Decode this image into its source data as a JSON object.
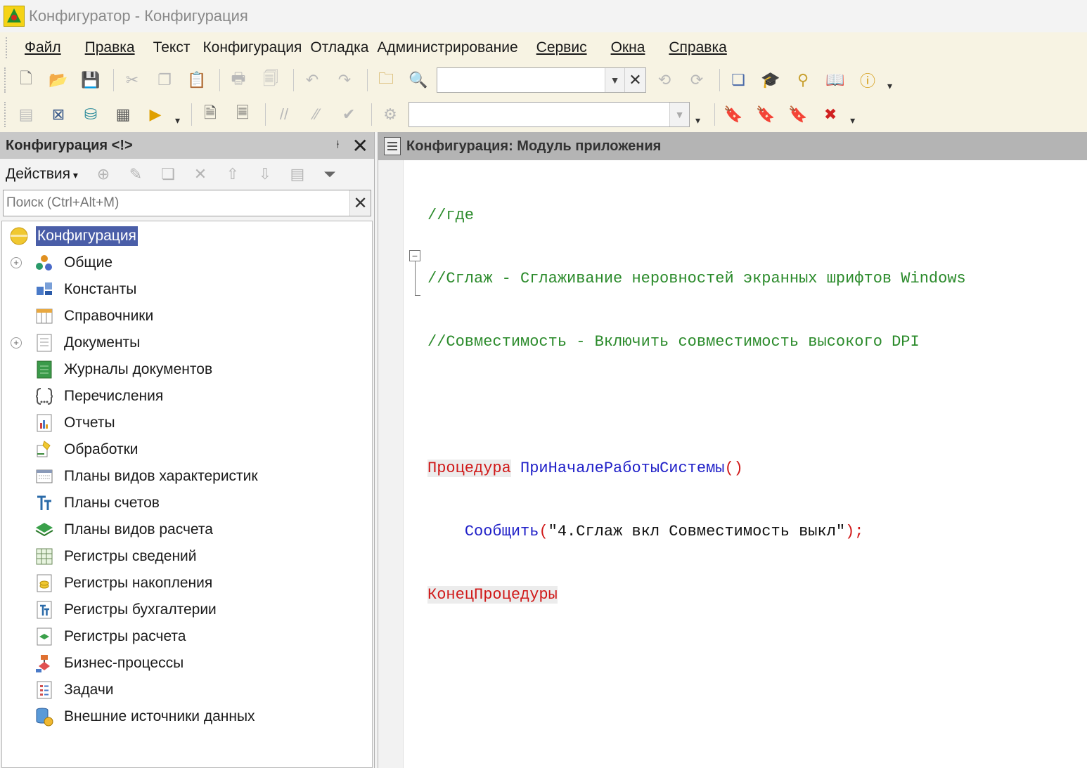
{
  "window": {
    "title": "Конфигуратор - Конфигурация"
  },
  "menu": [
    {
      "label": "Файл",
      "underline": true
    },
    {
      "label": "Правка",
      "underline": true
    },
    {
      "label": "Текст",
      "underline": false
    },
    {
      "label": "Конфигурация",
      "underline": false
    },
    {
      "label": "Отладка",
      "underline": false
    },
    {
      "label": "Администрирование",
      "underline": false
    },
    {
      "label": "Сервис",
      "underline": true
    },
    {
      "label": "Окна",
      "underline": true
    },
    {
      "label": "Справка",
      "underline": true
    }
  ],
  "toolbar1": {
    "search_value": "",
    "icons": [
      "new-document-icon",
      "open-icon",
      "save-icon",
      "cut-icon",
      "copy-icon",
      "paste-icon",
      "print-icon",
      "print-preview-icon",
      "undo-icon",
      "redo-icon",
      "find-in-files-icon",
      "find-icon",
      "back-search-icon",
      "forward-search-icon",
      "windows-icon",
      "wizard-icon",
      "syntax-helper-icon",
      "help-icon",
      "info-icon"
    ]
  },
  "toolbar2": {
    "procedure_combo_value": "",
    "icons": [
      "module-icon",
      "form-icon",
      "database-config-icon",
      "table-icon",
      "run-debug-icon",
      "text-block-icon",
      "text-block-alt-icon",
      "comment-icon",
      "uncomment-icon",
      "check-syntax-icon",
      "query-icon",
      "bookmark-add-icon",
      "bookmark-next-icon",
      "bookmark-prev-icon",
      "bookmark-clear-icon"
    ]
  },
  "left_panel": {
    "title": "Конфигурация <!>",
    "actions_label": "Действия",
    "search_placeholder": "Поиск (Ctrl+Alt+M)",
    "tree": {
      "root": "Конфигурация",
      "items": [
        {
          "label": "Общие",
          "icon": "common-icon",
          "expandable": true
        },
        {
          "label": "Константы",
          "icon": "constants-icon",
          "expandable": false
        },
        {
          "label": "Справочники",
          "icon": "catalogs-icon",
          "expandable": false
        },
        {
          "label": "Документы",
          "icon": "documents-icon",
          "expandable": true
        },
        {
          "label": "Журналы документов",
          "icon": "document-journals-icon",
          "expandable": false
        },
        {
          "label": "Перечисления",
          "icon": "enumerations-icon",
          "expandable": false
        },
        {
          "label": "Отчеты",
          "icon": "reports-icon",
          "expandable": false
        },
        {
          "label": "Обработки",
          "icon": "data-processors-icon",
          "expandable": false
        },
        {
          "label": "Планы видов характеристик",
          "icon": "characteristic-types-icon",
          "expandable": false
        },
        {
          "label": "Планы счетов",
          "icon": "chart-of-accounts-icon",
          "expandable": false
        },
        {
          "label": "Планы видов расчета",
          "icon": "calculation-types-icon",
          "expandable": false
        },
        {
          "label": "Регистры сведений",
          "icon": "information-registers-icon",
          "expandable": false
        },
        {
          "label": "Регистры накопления",
          "icon": "accumulation-registers-icon",
          "expandable": false
        },
        {
          "label": "Регистры бухгалтерии",
          "icon": "accounting-registers-icon",
          "expandable": false
        },
        {
          "label": "Регистры расчета",
          "icon": "calculation-registers-icon",
          "expandable": false
        },
        {
          "label": "Бизнес-процессы",
          "icon": "business-processes-icon",
          "expandable": false
        },
        {
          "label": "Задачи",
          "icon": "tasks-icon",
          "expandable": false
        },
        {
          "label": "Внешние источники данных",
          "icon": "external-data-sources-icon",
          "expandable": false
        }
      ]
    }
  },
  "editor": {
    "title": "Конфигурация: Модуль приложения",
    "code": {
      "line1": "//где",
      "line2": "//Сглаж - Сглаживание неровностей экранных шрифтов Windows",
      "line3": "//Совместимость - Включить совместимость высокого DPI",
      "proc_keyword": "Процедура",
      "proc_name": "ПриНачалеРаботыСистемы",
      "proc_parens": "()",
      "call_name": "Сообщить",
      "call_open": "(",
      "call_arg": "\"4.Сглаж вкл Совместимость выкл\"",
      "call_close": ");",
      "end_keyword": "КонецПроцедуры"
    }
  },
  "colors": {
    "comment": "#2a8a2a",
    "keyword": "#d01818",
    "function": "#2020c8",
    "selection": "#4a5ea8"
  }
}
